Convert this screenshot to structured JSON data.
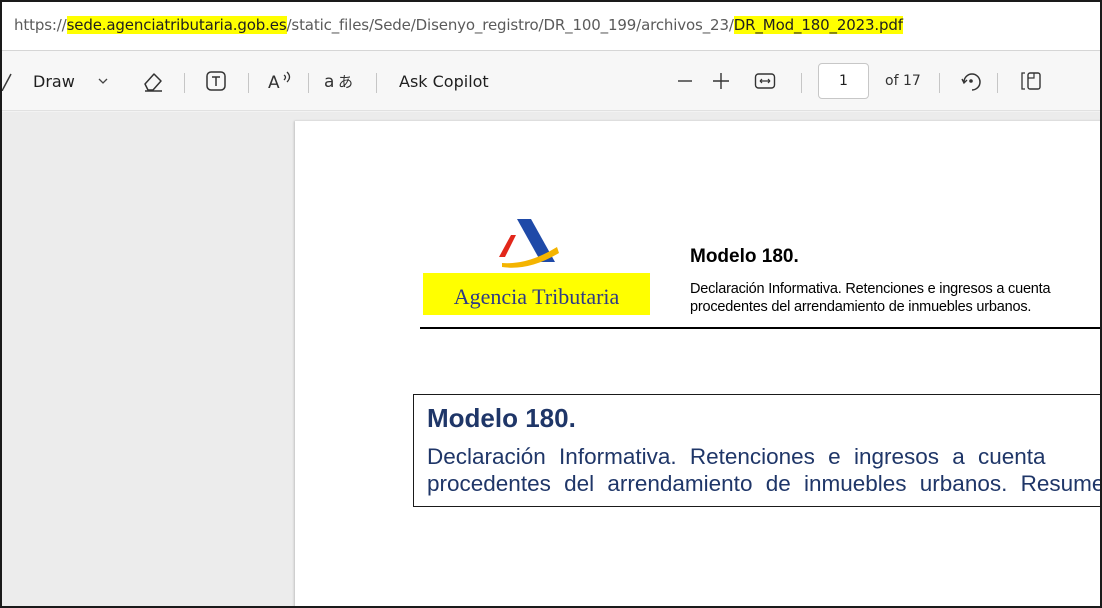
{
  "address_bar": {
    "url_scheme": "https://",
    "url_host": "sede.agenciatributaria.gob.es",
    "url_path": "/static_files/Sede/Disenyo_registro/DR_100_199/archivos_23/",
    "url_file": "DR_Mod_180_2023.pdf",
    "highlight_color": "#ffff00"
  },
  "toolbar": {
    "draw_label": "Draw",
    "ask_copilot_label": "Ask Copilot",
    "page_number": "1",
    "page_count_label": "of 17",
    "icons": [
      "draw-icon",
      "chevron-down-icon",
      "eraser-icon",
      "text-box-icon",
      "read-aloud-icon",
      "translate-icon",
      "zoom-out-icon",
      "zoom-in-icon",
      "fit-width-icon",
      "rotate-icon",
      "page-view-icon"
    ]
  },
  "document": {
    "logo_text": "Agencia Tributaria",
    "header_title": "Modelo 180.",
    "header_line1": "Declaración Informativa. Retenciones e ingresos a cuenta",
    "header_line2": "procedentes del arrendamiento de inmuebles urbanos.",
    "box_title": "Modelo 180.",
    "box_line1": "Declaración Informativa. Retenciones e ingresos a cuenta",
    "box_line2": "procedentes del arrendamiento de inmuebles urbanos. Resumen",
    "accent_color": "#1f3668",
    "logo_highlight": "#ffff00"
  }
}
